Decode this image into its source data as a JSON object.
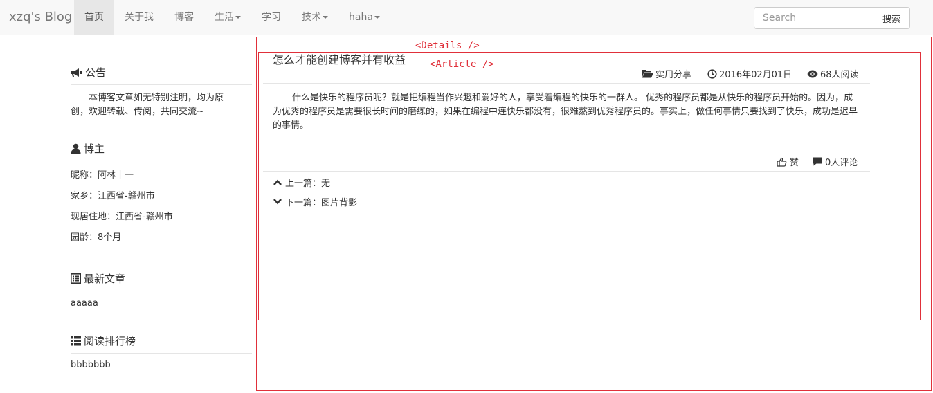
{
  "navbar": {
    "brand": "xzq's Blog",
    "items": [
      {
        "label": "首页",
        "active": true,
        "dropdown": false
      },
      {
        "label": "关于我",
        "active": false,
        "dropdown": false
      },
      {
        "label": "博客",
        "active": false,
        "dropdown": false
      },
      {
        "label": "生活",
        "active": false,
        "dropdown": true
      },
      {
        "label": "学习",
        "active": false,
        "dropdown": false
      },
      {
        "label": "技术",
        "active": false,
        "dropdown": true
      },
      {
        "label": "haha",
        "active": false,
        "dropdown": true
      }
    ],
    "search_placeholder": "Search",
    "search_button": "搜索"
  },
  "sidebar": {
    "notice": {
      "title": "公告",
      "icon": "bullhorn-icon",
      "text": "本博客文章如无特别注明，均为原创，欢迎转载、传阅，共同交流~"
    },
    "blogger": {
      "title": "博主",
      "icon": "user-icon",
      "nickname": "昵称：阿林十一",
      "hometown": "家乡：江西省-赣州市",
      "residence": "现居住地：江西省-赣州市",
      "age": "园龄：8个月"
    },
    "latest": {
      "title": "最新文章",
      "icon": "list-alt-icon",
      "item": "aaaaa"
    },
    "ranking": {
      "title": "阅读排行榜",
      "icon": "th-list-icon",
      "item": "bbbbbbb"
    }
  },
  "debug": {
    "details_tag": "<Details />",
    "article_tag": "<Article />",
    "color": "#e0303a"
  },
  "article": {
    "title": "怎么才能创建博客并有收益",
    "category": "实用分享",
    "date": "2016年02月01日",
    "views": "68人阅读",
    "content": "什么是快乐的程序员呢？就是把编程当作兴趣和爱好的人，享受着编程的快乐的一群人。 优秀的程序员都是从快乐的程序员开始的。因为，成为优秀的程序员是需要很长时间的磨练的，如果在编程中连快乐都没有，很难熬到优秀程序员的。事实上，做任何事情只要找到了快乐，成功是迟早的事情。",
    "like": "赞",
    "comments": "0人评论",
    "prev": "上一篇：无",
    "next": "下一篇：图片背影"
  }
}
